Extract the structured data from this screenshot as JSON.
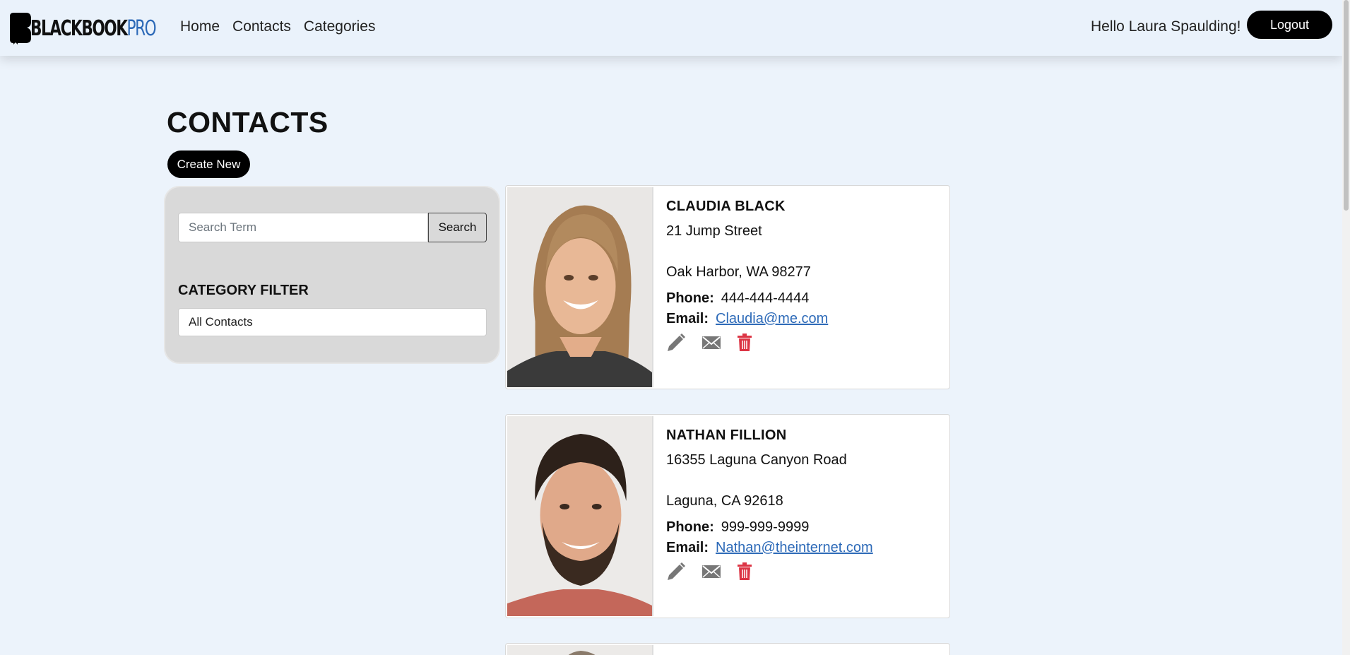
{
  "nav": {
    "logo_text_main": "BLACKBOOK",
    "logo_text_pro": "PRO",
    "links": [
      "Home",
      "Contacts",
      "Categories"
    ],
    "greeting": "Hello Laura Spaulding!",
    "logout_label": "Logout"
  },
  "page": {
    "title": "CONTACTS",
    "create_label": "Create New"
  },
  "filter": {
    "search_placeholder": "Search Term",
    "search_label": "Search",
    "heading": "CATEGORY FILTER",
    "selected_category": "All Contacts"
  },
  "contacts": [
    {
      "name": "CLAUDIA BLACK",
      "address1": "21 Jump Street",
      "address2": "Oak Harbor, WA 98277",
      "phone_label": "Phone:",
      "phone": "444-444-4444",
      "email_label": "Email:",
      "email": "Claudia@me.com",
      "photo": "woman-smiling-photo"
    },
    {
      "name": "NATHAN FILLION",
      "address1": "16355 Laguna Canyon Road",
      "address2": "Laguna, CA 92618",
      "phone_label": "Phone:",
      "phone": "999-999-9999",
      "email_label": "Email:",
      "email": "Nathan@theinternet.com",
      "photo": "bearded-man-smiling-photo"
    }
  ],
  "colors": {
    "background": "#ecf3fb",
    "link": "#2d6ab8",
    "delete": "#dc3545",
    "icon_gray": "#777777"
  },
  "icons": [
    "pencil-icon",
    "envelope-icon",
    "trash-icon"
  ]
}
